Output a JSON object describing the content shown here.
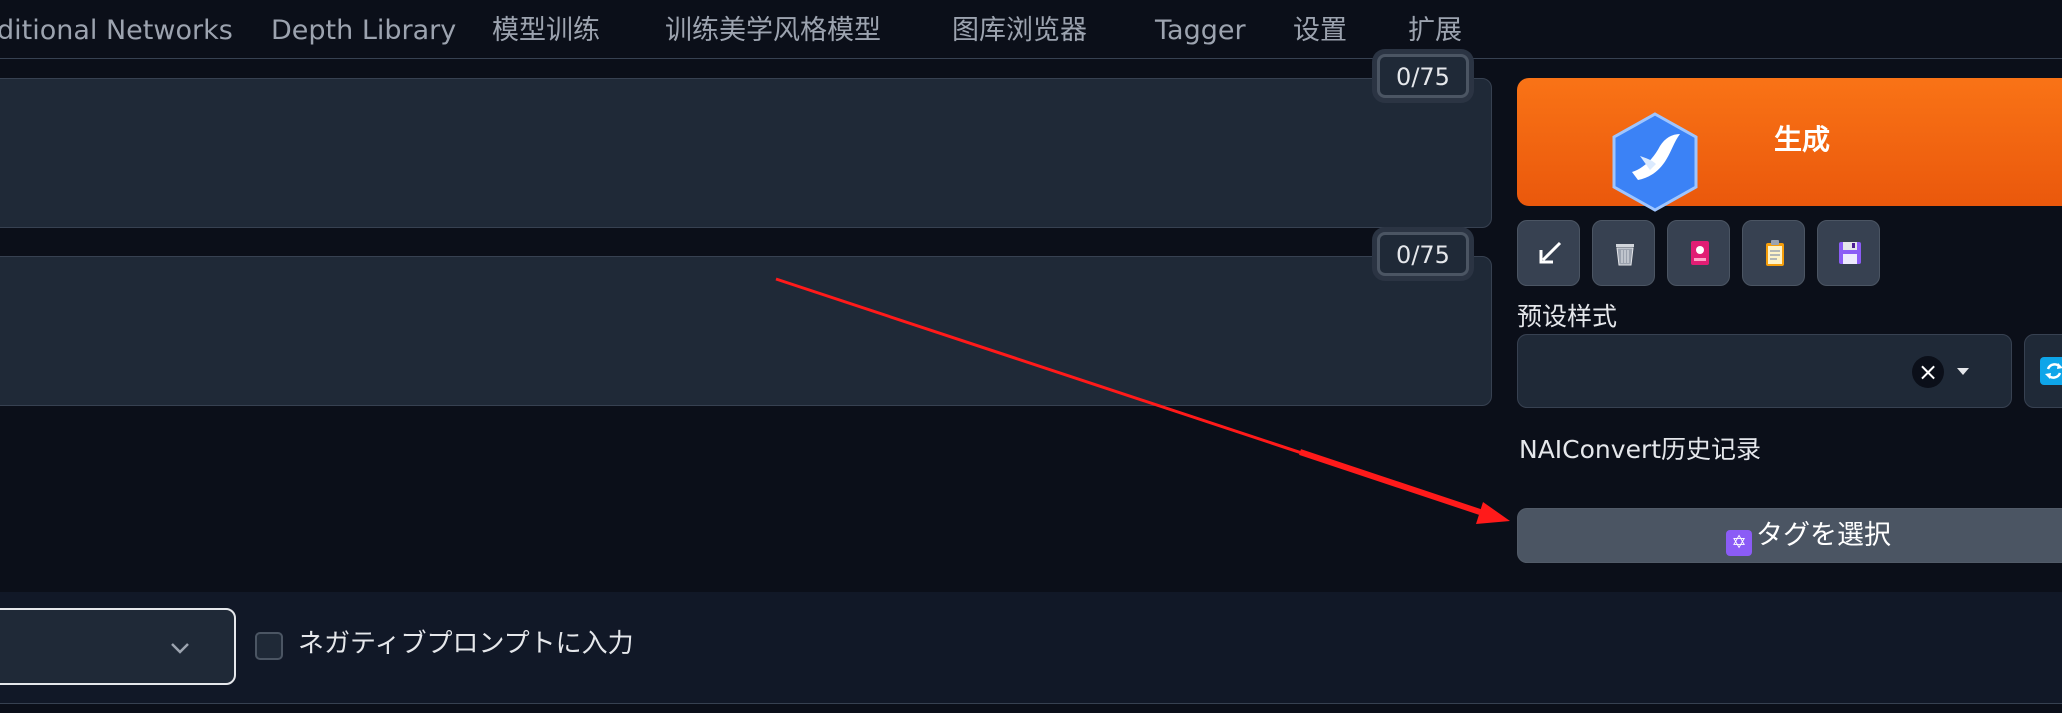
{
  "tabs": [
    {
      "label": "ditional Networks"
    },
    {
      "label": "Depth Library"
    },
    {
      "label": "模型训练"
    },
    {
      "label": "训练美学风格模型"
    },
    {
      "label": "图库浏览器"
    },
    {
      "label": "Tagger"
    },
    {
      "label": "设置"
    },
    {
      "label": "扩展"
    }
  ],
  "prompt": {
    "token_counter": "0/75"
  },
  "negative_prompt": {
    "token_counter": "0/75"
  },
  "generate": {
    "label": "生成"
  },
  "toolbar": {
    "icons": [
      "arrow-down-left-icon",
      "trash-icon",
      "red-card-icon",
      "clipboard-icon",
      "save-icon"
    ]
  },
  "styles": {
    "label": "预设样式",
    "clear": "×"
  },
  "naiconvert": {
    "label": "NAIConvert历史记录"
  },
  "select_tags": {
    "label": "タグを選択",
    "badge": "✡"
  },
  "negative_checkbox": {
    "label": "ネガティブプロンプトに入力",
    "checked": false
  },
  "colors": {
    "background": "#0b0f19",
    "panel": "#1f2937",
    "accent": "#f97316",
    "annotation_arrow": "#ff1a1a"
  }
}
